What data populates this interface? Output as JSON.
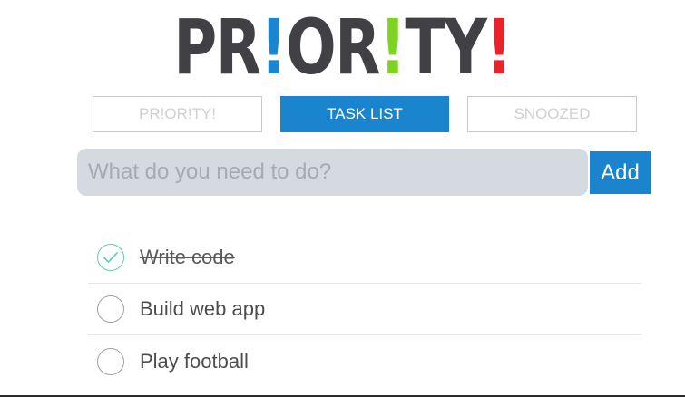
{
  "logo": {
    "parts": [
      "PR",
      "!",
      "OR",
      "!",
      "TY",
      "!"
    ],
    "colors": {
      "first": "#1a86d0",
      "second": "#7ed321",
      "third": "#e8232b",
      "text": "#404045"
    }
  },
  "tabs": [
    {
      "label": "PR!OR!TY!",
      "active": false
    },
    {
      "label": "TASK LIST",
      "active": true
    },
    {
      "label": "SNOOZED",
      "active": false
    }
  ],
  "new_task": {
    "placeholder": "What do you need to do?",
    "value": "",
    "add_label": "Add"
  },
  "tasks": [
    {
      "label": "Write code",
      "done": true
    },
    {
      "label": "Build web app",
      "done": false
    },
    {
      "label": "Play football",
      "done": false
    }
  ],
  "colors": {
    "accent": "#1b84cf",
    "check": "#5fc9b3"
  }
}
